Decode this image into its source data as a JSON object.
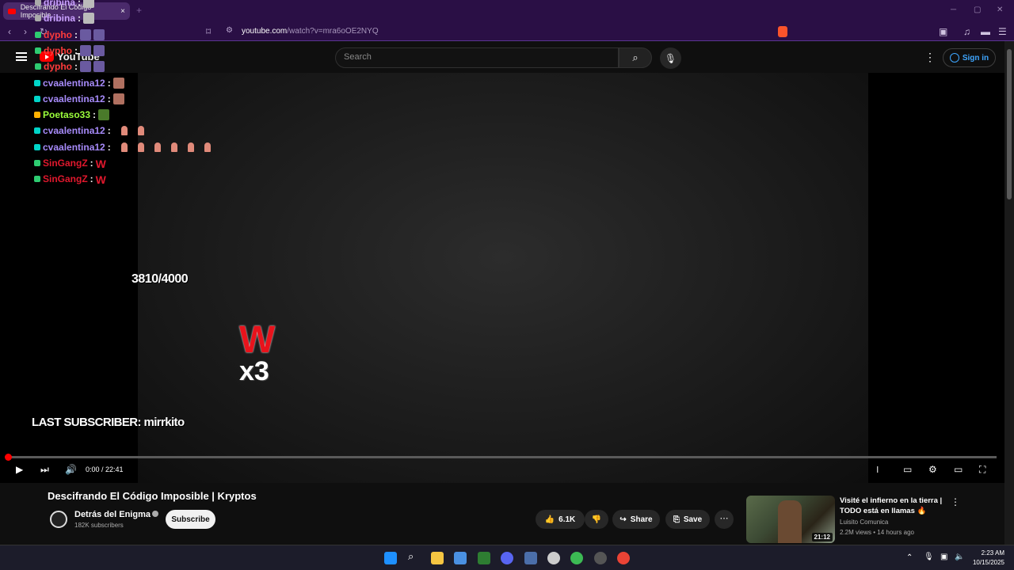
{
  "browser": {
    "tab_title": "Descifrando El Código Imposible",
    "tab_close": "×",
    "new_tab": "+",
    "url_host": "youtube.com",
    "url_path": "/watch?v=mra6oOE2NYQ",
    "win_min": "─",
    "win_max": "▢",
    "win_close": "✕"
  },
  "youtube": {
    "logo_text": "YouTube",
    "search_placeholder": "Search",
    "sign_in": "Sign in"
  },
  "chat": [
    {
      "user": "dribina",
      "color": "#c9a0ff"
    },
    {
      "user": "dribina",
      "color": "#c9a0ff"
    },
    {
      "user": "dypho",
      "color": "#ff3b3b"
    },
    {
      "user": "dypho",
      "color": "#ff3b3b"
    },
    {
      "user": "dypho",
      "color": "#ff3b3b"
    },
    {
      "user": "cvaalentina12",
      "color": "#a78bfa"
    },
    {
      "user": "cvaalentina12",
      "color": "#a78bfa"
    },
    {
      "user": "Poetaso33",
      "color": "#9cff3b"
    },
    {
      "user": "cvaalentina12",
      "color": "#a78bfa"
    },
    {
      "user": "cvaalentina12",
      "color": "#a78bfa"
    },
    {
      "user": "SinGangZ",
      "color": "#e0182d"
    },
    {
      "user": "SinGangZ",
      "color": "#e0182d"
    }
  ],
  "chat_separator": ":",
  "overlay": {
    "counter": "3810/4000",
    "w_letter": "W",
    "multiplier": "x3",
    "last_subscriber": "LAST SUBSCRIBER: mirrkito"
  },
  "player": {
    "time": "0:00 / 22:41",
    "progress_fraction": 0.0
  },
  "video": {
    "title": "Descifrando El Código Imposible | Kryptos",
    "channel": "Detrás del Enigma",
    "subscribers": "182K subscribers",
    "subscribe_label": "Subscribe",
    "likes": "6.1K",
    "share_label": "Share",
    "save_label": "Save"
  },
  "recommendation": {
    "title": "Visité el infierno en la tierra | TODO está en llamas 🔥",
    "channel": "Luisito Comunica",
    "meta": "2.2M views • 14 hours ago",
    "duration": "21:12"
  },
  "taskbar": {
    "time": "2:23 AM",
    "date": "10/15/2025"
  }
}
